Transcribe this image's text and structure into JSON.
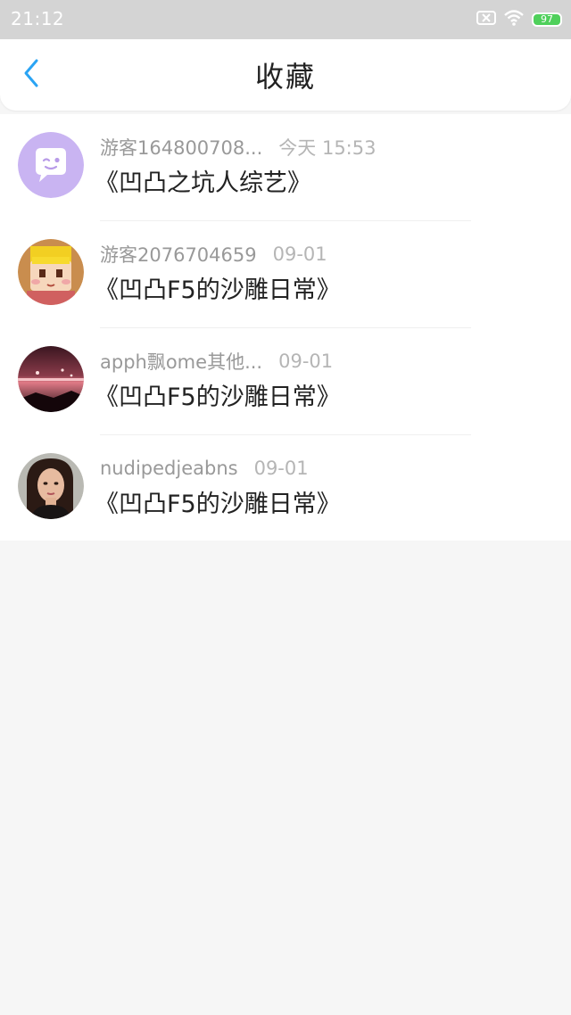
{
  "status_bar": {
    "time": "21:12",
    "battery": "97",
    "icons": [
      "sim-x-icon",
      "wifi-icon",
      "battery-icon"
    ]
  },
  "nav": {
    "back_icon": "chevron-left-icon",
    "title": "收藏"
  },
  "colors": {
    "accent": "#2aa4f4",
    "battery": "#4fd05b",
    "status_bar": "#d4d4d4"
  },
  "favorites": [
    {
      "user": "游客164800708...",
      "time": "今天 15:53",
      "title": "《凹凸之坑人综艺》",
      "avatar": "purple-chat-bubble-avatar"
    },
    {
      "user": "游客2076704659",
      "time": "09-01",
      "title": "《凹凸F5的沙雕日常》",
      "avatar": "cartoon-character-avatar"
    },
    {
      "user": "apph飘ome其他...",
      "time": "09-01",
      "title": "《凹凸F5的沙雕日常》",
      "avatar": "night-landscape-avatar"
    },
    {
      "user": "nudipedjeabns",
      "time": "09-01",
      "title": "《凹凸F5的沙雕日常》",
      "avatar": "portrait-photo-avatar"
    }
  ]
}
